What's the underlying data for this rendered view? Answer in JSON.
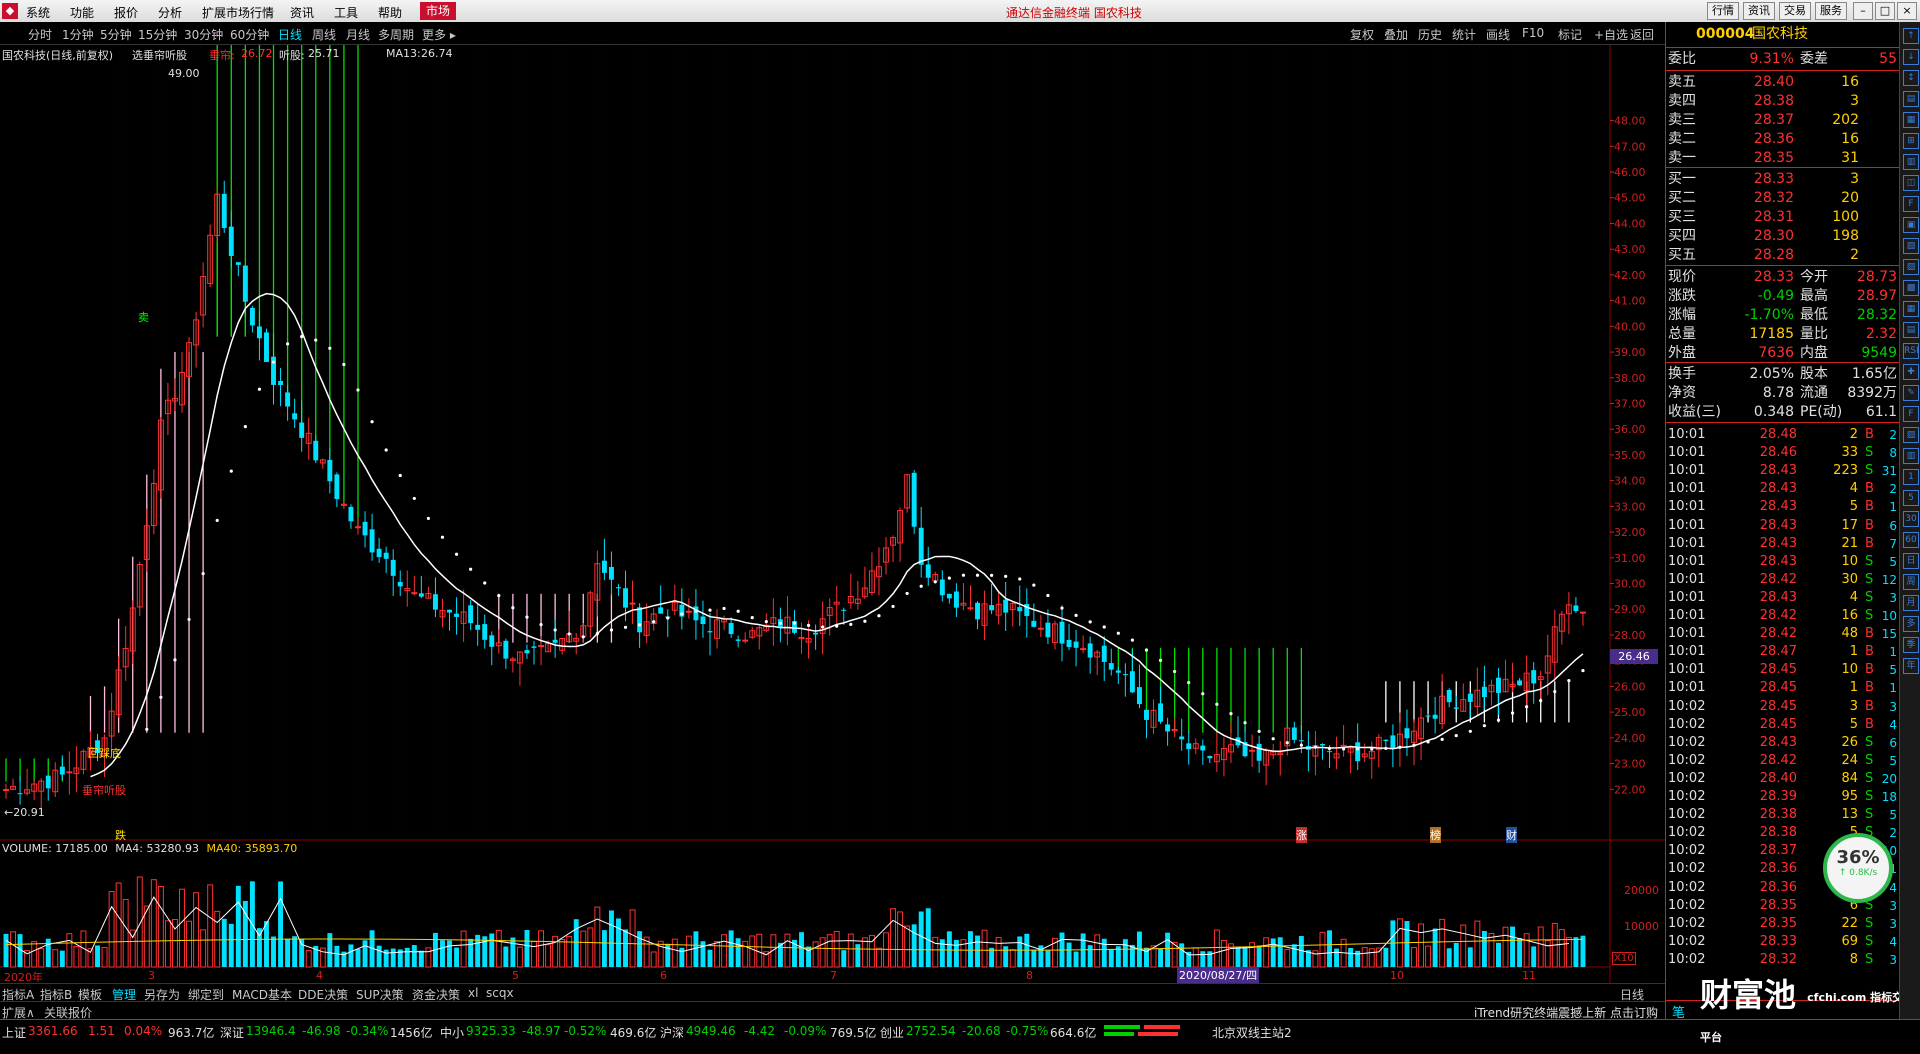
{
  "app": {
    "logo": "◆",
    "menu": [
      "系统",
      "功能",
      "报价",
      "分析",
      "扩展市场行情",
      "资讯",
      "工具",
      "帮助"
    ],
    "market_label": "市场",
    "title": "通达信金融终端  国农科技",
    "right_buttons": [
      "行情",
      "资讯",
      "交易",
      "服务"
    ],
    "window_controls": [
      "–",
      "□",
      "×"
    ]
  },
  "periods": {
    "items": [
      "分时",
      "1分钟",
      "5分钟",
      "15分钟",
      "30分钟",
      "60分钟",
      "日线",
      "周线",
      "月线",
      "多周期",
      "更多 ▸"
    ],
    "active_index": 6
  },
  "toolbar": [
    "复权",
    "叠加",
    "历史",
    "统计",
    "画线",
    "F10",
    "标记",
    "+自选",
    "返回"
  ],
  "chart_info": {
    "stock": "国农科技(日线,前复权)",
    "indicator_name": "选垂帘听股",
    "label1": "垂帘:",
    "val1": "26.72",
    "label2": "听股:",
    "val2": "25.71",
    "ma_label": "MA13:",
    "ma_val": "26.74"
  },
  "chart_labels": {
    "top_price": "49.00",
    "low_price": "←20.91",
    "current_price": "26.46",
    "start_year": "2020年",
    "date_marker": "2020/08/27/四",
    "signal_di": "回踩底",
    "signal_tingu": "垂帘听股",
    "signal_sell": "卖",
    "mark_die": "跌",
    "mark_zhang": "涨",
    "mark_bang": "榜",
    "mark_cai": "财",
    "x_months": [
      "3",
      "4",
      "5",
      "6",
      "7",
      "8",
      "9",
      "10",
      "11"
    ],
    "volume_scale": "X10"
  },
  "volume_info": {
    "label": "VOLUME:",
    "value": "17185.00",
    "ma4_label": "MA4:",
    "ma4": "53280.93",
    "ma40_label": "MA40:",
    "ma40": "35893.70",
    "y_ticks": [
      "20000",
      "10000"
    ]
  },
  "chart_data": {
    "type": "candlestick",
    "title": "国农科技(日线,前复权)",
    "ylim": [
      21.0,
      49.5
    ],
    "y_ticks": [
      "48.00",
      "47.00",
      "46.00",
      "45.00",
      "44.00",
      "43.00",
      "42.00",
      "41.00",
      "40.00",
      "39.00",
      "38.00",
      "37.00",
      "36.00",
      "35.00",
      "34.00",
      "33.00",
      "32.00",
      "31.00",
      "30.00",
      "29.00",
      "28.00",
      "27.00",
      "26.00",
      "25.00",
      "24.00",
      "23.00",
      "22.00"
    ],
    "high": 49.0,
    "low": 20.91,
    "last_close": 26.46,
    "ma13_last": 26.74,
    "volume_ylim": [
      0,
      30000
    ]
  },
  "tabs": {
    "items": [
      "指标A",
      "指标B",
      "模板",
      "管理",
      "另存为",
      "绑定到",
      "MACD基本",
      "DDE决策",
      "SUP决策",
      "资金决策",
      "xl",
      "scqx"
    ],
    "active_index": 3,
    "right_label": "日线"
  },
  "subbar": {
    "items": [
      "扩展∧",
      "关联报价"
    ],
    "news": "iTrend研究终端震撼上新 点击订购"
  },
  "status": {
    "sh_label": "上证",
    "sh_val": "3361.66",
    "sh_chg": "1.51",
    "sh_pct": "0.04%",
    "sh_amt": "963.7亿",
    "sz_label": "深证",
    "sz_val": "13946.4",
    "sz_chg": "-46.98",
    "sz_pct": "-0.34%",
    "sz_amt": "1456亿",
    "zx_label": "中小",
    "zx_val": "9325.33",
    "zx_chg": "-48.97",
    "zx_pct": "-0.52%",
    "zx_amt": "469.6亿",
    "hs_label": "沪深",
    "hs_val": "4949.46",
    "hs_chg": "-4.42",
    "hs_pct": "-0.09%",
    "hs_amt": "769.5亿",
    "cy_label": "创业",
    "cy_val": "2752.54",
    "cy_chg": "-20.68",
    "cy_pct": "-0.75%",
    "cy_amt": "664.6亿",
    "server": "北京双线主站2"
  },
  "quote": {
    "code": "000004",
    "name": "国农科技",
    "wb_label": "委比",
    "wb": "9.31%",
    "wc_label": "委差",
    "wc": "55",
    "asks": [
      {
        "label": "卖五",
        "price": "28.40",
        "vol": "16"
      },
      {
        "label": "卖四",
        "price": "28.38",
        "vol": "3"
      },
      {
        "label": "卖三",
        "price": "28.37",
        "vol": "202"
      },
      {
        "label": "卖二",
        "price": "28.36",
        "vol": "16"
      },
      {
        "label": "卖一",
        "price": "28.35",
        "vol": "31"
      }
    ],
    "bids": [
      {
        "label": "买一",
        "price": "28.33",
        "vol": "3"
      },
      {
        "label": "买二",
        "price": "28.32",
        "vol": "20"
      },
      {
        "label": "买三",
        "price": "28.31",
        "vol": "100"
      },
      {
        "label": "买四",
        "price": "28.30",
        "vol": "198"
      },
      {
        "label": "买五",
        "price": "28.28",
        "vol": "2"
      }
    ],
    "stats": [
      {
        "l1": "现价",
        "v1": "28.33",
        "c1": "#ff3030",
        "l2": "今开",
        "v2": "28.73",
        "c2": "#ff3030"
      },
      {
        "l1": "涨跌",
        "v1": "-0.49",
        "c1": "#00d000",
        "l2": "最高",
        "v2": "28.97",
        "c2": "#ff3030"
      },
      {
        "l1": "涨幅",
        "v1": "-1.70%",
        "c1": "#00d000",
        "l2": "最低",
        "v2": "28.32",
        "c2": "#00d000"
      },
      {
        "l1": "总量",
        "v1": "17185",
        "c1": "#ffd000",
        "l2": "量比",
        "v2": "2.32",
        "c2": "#ff3030"
      },
      {
        "l1": "外盘",
        "v1": "7636",
        "c1": "#ff3030",
        "l2": "内盘",
        "v2": "9549",
        "c2": "#00d000"
      }
    ],
    "stats2": [
      {
        "l1": "换手",
        "v1": "2.05%",
        "l2": "股本",
        "v2": "1.65亿"
      },
      {
        "l1": "净资",
        "v1": "8.78",
        "l2": "流通",
        "v2": "8392万"
      },
      {
        "l1": "收益(三)",
        "v1": "0.348",
        "l2": "PE(动)",
        "v2": "61.1"
      }
    ],
    "ticks": [
      {
        "t": "10:01",
        "p": "28.48",
        "v": "2",
        "s": "B",
        "n": "2"
      },
      {
        "t": "10:01",
        "p": "28.46",
        "v": "33",
        "s": "S",
        "n": "8"
      },
      {
        "t": "10:01",
        "p": "28.43",
        "v": "223",
        "s": "S",
        "n": "31"
      },
      {
        "t": "10:01",
        "p": "28.43",
        "v": "4",
        "s": "B",
        "n": "2"
      },
      {
        "t": "10:01",
        "p": "28.43",
        "v": "5",
        "s": "B",
        "n": "1"
      },
      {
        "t": "10:01",
        "p": "28.43",
        "v": "17",
        "s": "B",
        "n": "6"
      },
      {
        "t": "10:01",
        "p": "28.43",
        "v": "21",
        "s": "B",
        "n": "7"
      },
      {
        "t": "10:01",
        "p": "28.43",
        "v": "10",
        "s": "S",
        "n": "5"
      },
      {
        "t": "10:01",
        "p": "28.42",
        "v": "30",
        "s": "S",
        "n": "12"
      },
      {
        "t": "10:01",
        "p": "28.43",
        "v": "4",
        "s": "S",
        "n": "3"
      },
      {
        "t": "10:01",
        "p": "28.42",
        "v": "16",
        "s": "S",
        "n": "10"
      },
      {
        "t": "10:01",
        "p": "28.42",
        "v": "48",
        "s": "B",
        "n": "15"
      },
      {
        "t": "10:01",
        "p": "28.47",
        "v": "1",
        "s": "B",
        "n": "1"
      },
      {
        "t": "10:01",
        "p": "28.45",
        "v": "10",
        "s": "B",
        "n": "5"
      },
      {
        "t": "10:01",
        "p": "28.45",
        "v": "1",
        "s": "B",
        "n": "1"
      },
      {
        "t": "10:02",
        "p": "28.45",
        "v": "3",
        "s": "B",
        "n": "3"
      },
      {
        "t": "10:02",
        "p": "28.45",
        "v": "5",
        "s": "B",
        "n": "4"
      },
      {
        "t": "10:02",
        "p": "28.43",
        "v": "26",
        "s": "S",
        "n": "6"
      },
      {
        "t": "10:02",
        "p": "28.42",
        "v": "24",
        "s": "S",
        "n": "5"
      },
      {
        "t": "10:02",
        "p": "28.40",
        "v": "84",
        "s": "S",
        "n": "20"
      },
      {
        "t": "10:02",
        "p": "28.39",
        "v": "95",
        "s": "S",
        "n": "18"
      },
      {
        "t": "10:02",
        "p": "28.38",
        "v": "13",
        "s": "S",
        "n": "5"
      },
      {
        "t": "10:02",
        "p": "28.38",
        "v": "5",
        "s": "S",
        "n": "2"
      },
      {
        "t": "10:02",
        "p": "28.37",
        "v": "46",
        "s": "S",
        "n": "10"
      },
      {
        "t": "10:02",
        "p": "28.36",
        "v": "1",
        "s": "S",
        "n": "1"
      },
      {
        "t": "10:02",
        "p": "28.36",
        "v": "11",
        "s": "S",
        "n": "4"
      },
      {
        "t": "10:02",
        "p": "28.35",
        "v": "6",
        "s": "S",
        "n": "3"
      },
      {
        "t": "10:02",
        "p": "28.35",
        "v": "22",
        "s": "S",
        "n": "3"
      },
      {
        "t": "10:02",
        "p": "28.33",
        "v": "69",
        "s": "S",
        "n": "4"
      },
      {
        "t": "10:02",
        "p": "28.32",
        "v": "8",
        "s": "S",
        "n": "3"
      }
    ],
    "ticks_footer": "笔",
    "gauge_pct": "36%",
    "gauge_speed": "↑ 0.8K/s"
  },
  "strip_icons": [
    "↑",
    "↓",
    "↕",
    "▤",
    "▦",
    "⊞",
    "▥",
    "◫",
    "F",
    "▣",
    "▧",
    "▨",
    "▩",
    "▦",
    "▤",
    "RSI",
    "✚",
    "✎",
    "F",
    "▧",
    "▥",
    "1",
    "5",
    "30",
    "60",
    "日",
    "周",
    "月",
    "多",
    "季",
    "年"
  ],
  "watermark": "财富池",
  "watermark_sub": "cfchi.com 指标交易平台"
}
